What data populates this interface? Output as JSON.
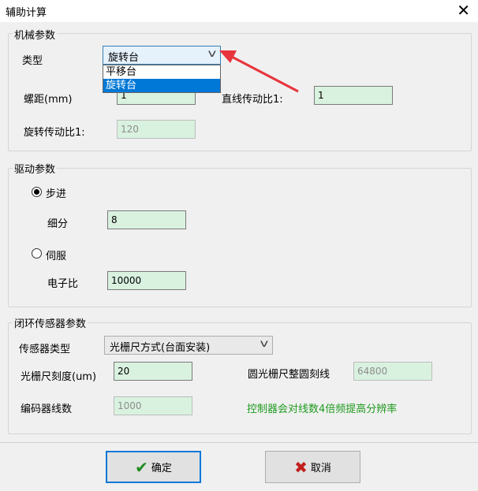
{
  "window": {
    "title": "辅助计算"
  },
  "machine": {
    "group_label": "机械参数",
    "type_label": "类型",
    "type_value": "旋转台",
    "type_options": [
      "平移台",
      "旋转台"
    ],
    "pitch_label": "螺距(mm)",
    "pitch_value": "1",
    "linear_ratio_label": "直线传动比1:",
    "linear_ratio_value": "1",
    "rot_ratio_label": "旋转传动比1:",
    "rot_ratio_value": "120"
  },
  "drive": {
    "group_label": "驱动参数",
    "stepper_label": "步进",
    "subdiv_label": "细分",
    "subdiv_value": "8",
    "servo_label": "伺服",
    "gear_label": "电子比",
    "gear_value": "10000"
  },
  "sensor": {
    "group_label": "闭环传感器参数",
    "type_label": "传感器类型",
    "type_value": "光栅尺方式(台面安装)",
    "scale_label": "光栅尺刻度(um)",
    "scale_value": "20",
    "circle_label": "圆光栅尺整圆刻线",
    "circle_value": "64800",
    "encoder_label": "编码器线数",
    "encoder_value": "1000",
    "note": "控制器会对线数4倍频提高分辨率",
    "note_color": "#1e9a1e"
  },
  "buttons": {
    "ok": "确定",
    "cancel": "取消"
  },
  "icons": {
    "ok": "checkmark-icon",
    "cancel": "x-icon",
    "close": "close-icon",
    "chevron": "chevron-down-icon",
    "annotation": "red-arrow"
  }
}
